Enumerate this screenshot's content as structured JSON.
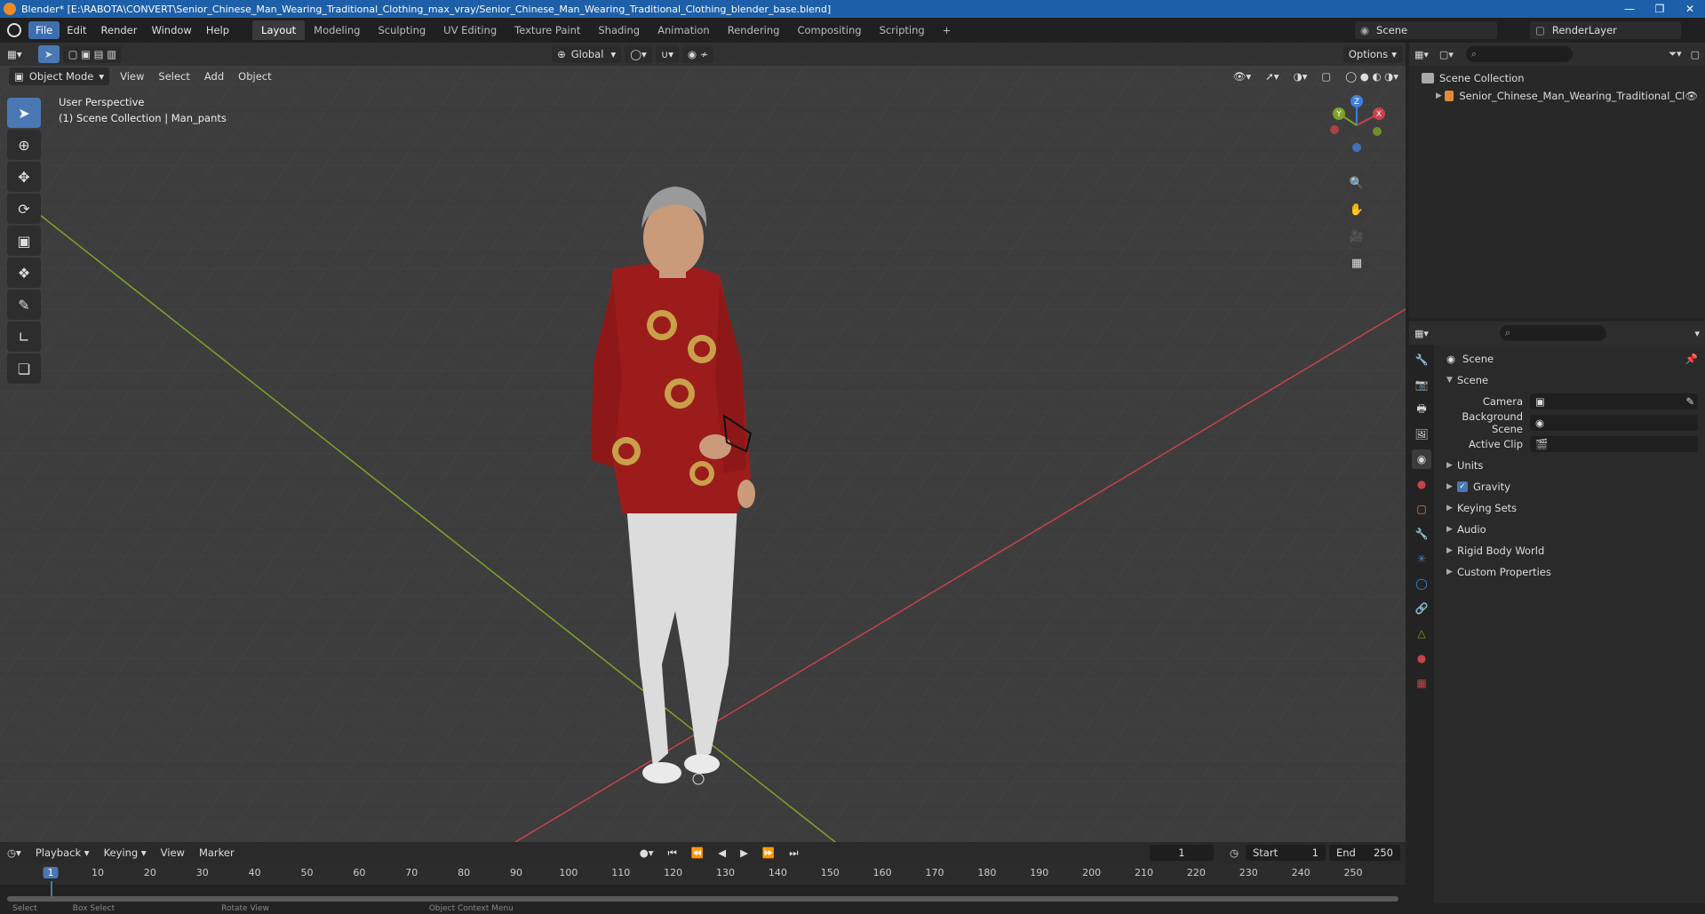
{
  "window": {
    "title": "Blender* [E:\\RABOTA\\CONVERT\\Senior_Chinese_Man_Wearing_Traditional_Clothing_max_vray/Senior_Chinese_Man_Wearing_Traditional_Clothing_blender_base.blend]"
  },
  "menu": [
    "File",
    "Edit",
    "Render",
    "Window",
    "Help"
  ],
  "workspaces": [
    "Layout",
    "Modeling",
    "Sculpting",
    "UV Editing",
    "Texture Paint",
    "Shading",
    "Animation",
    "Rendering",
    "Compositing",
    "Scripting"
  ],
  "active_workspace": "Layout",
  "top_right": {
    "scene": "Scene",
    "render_layer": "RenderLayer"
  },
  "viewport": {
    "transform_orientation": "Global",
    "options_label": "Options",
    "mode": "Object Mode",
    "menus": [
      "View",
      "Select",
      "Add",
      "Object"
    ],
    "overlay_line1": "User Perspective",
    "overlay_line2": "(1) Scene Collection | Man_pants",
    "gizmo_axes": {
      "z": "Z",
      "y": "Y",
      "x": "X"
    }
  },
  "outliner": {
    "root": "Scene Collection",
    "items": [
      {
        "label": "Senior_Chinese_Man_Wearing_Traditional_Cl"
      }
    ]
  },
  "properties": {
    "breadcrumb": "Scene",
    "panel_title": "Scene",
    "fields": [
      {
        "label": "Camera",
        "value": ""
      },
      {
        "label": "Background Scene",
        "value": ""
      },
      {
        "label": "Active Clip",
        "value": ""
      }
    ],
    "sections": [
      "Units",
      "Gravity",
      "Keying Sets",
      "Audio",
      "Rigid Body World",
      "Custom Properties"
    ],
    "gravity_enabled": true
  },
  "timeline": {
    "menus": [
      "Playback",
      "Keying",
      "View",
      "Marker"
    ],
    "current_frame": "1",
    "start_label": "Start",
    "start": "1",
    "end_label": "End",
    "end": "250",
    "ruler": [
      "1",
      "10",
      "20",
      "30",
      "40",
      "50",
      "60",
      "70",
      "80",
      "90",
      "100",
      "110",
      "120",
      "130",
      "140",
      "150",
      "160",
      "170",
      "180",
      "190",
      "200",
      "210",
      "220",
      "230",
      "240",
      "250"
    ]
  },
  "status": {
    "select": "Select",
    "box_select": "Box Select",
    "rotate": "Rotate View",
    "context": "Object Context Menu"
  },
  "colors": {
    "accent": "#4a78b4",
    "title_bar": "#1d5fa8",
    "x_axis": "#c8424a",
    "y_axis": "#7ea32a"
  }
}
